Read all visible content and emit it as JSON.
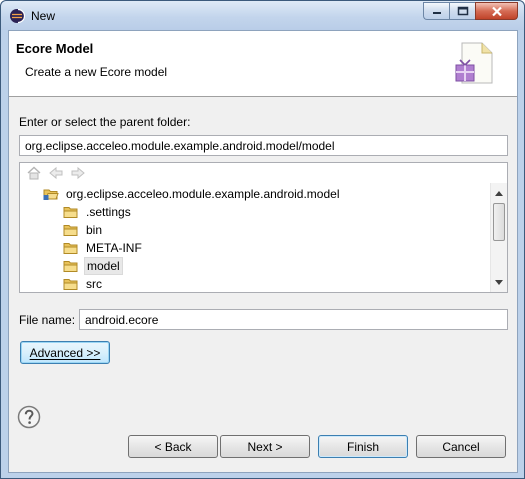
{
  "window": {
    "title": "New"
  },
  "header": {
    "title": "Ecore Model",
    "description": "Create a new Ecore model"
  },
  "parent_folder": {
    "label": "Enter or select the parent folder:",
    "value": "org.eclipse.acceleo.module.example.android.model/model"
  },
  "tree": {
    "root": "org.eclipse.acceleo.module.example.android.model",
    "children": [
      ".settings",
      "bin",
      "META-INF",
      "model",
      "src"
    ],
    "selected": "model"
  },
  "file_name": {
    "label": "File name:",
    "value": "android.ecore"
  },
  "advanced_button": {
    "label": "Advanced >>"
  },
  "footer": {
    "back": "< Back",
    "next": "Next >",
    "finish": "Finish",
    "cancel": "Cancel"
  },
  "colors": {
    "folder": "#e8c25a",
    "accent": "#3c7fb1",
    "close": "#c0432a"
  }
}
